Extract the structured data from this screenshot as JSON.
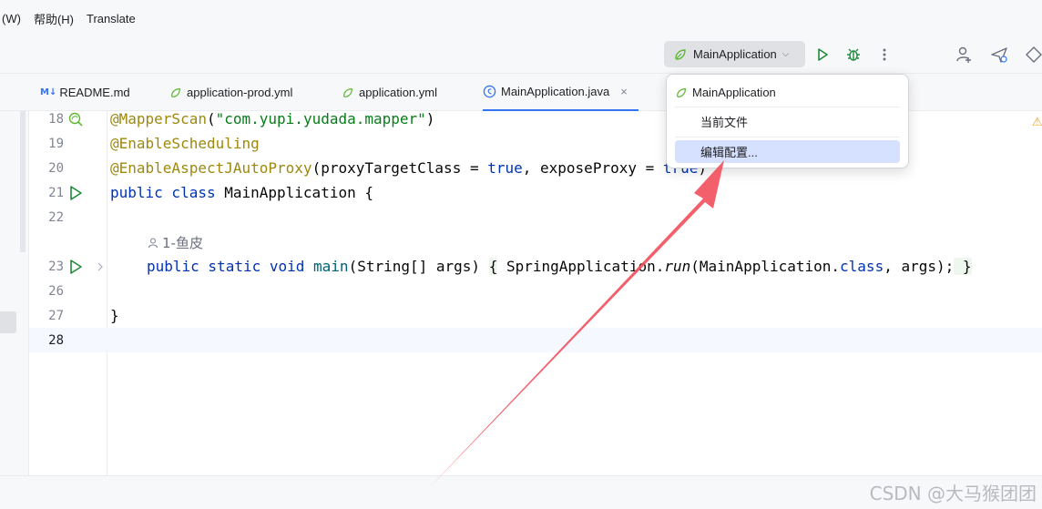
{
  "menu": [
    "(W)",
    "帮助(H)",
    "Translate"
  ],
  "toolbar": {
    "run_config": "MainApplication",
    "icons": [
      "run-icon",
      "debug-icon",
      "more-icon",
      "add-user-icon",
      "deploy-icon",
      "plugin-icon"
    ]
  },
  "tabs": [
    {
      "label": "README.md",
      "badge": "M↓"
    },
    {
      "label": "application-prod.yml"
    },
    {
      "label": "application.yml"
    },
    {
      "label": "MainApplication.java",
      "active": true,
      "close": "×"
    }
  ],
  "editor": {
    "line_numbers": [
      "18",
      "19",
      "20",
      "21",
      "22",
      "23",
      "26",
      "27",
      "28"
    ],
    "lines": {
      "l18_ann": "@MapperScan",
      "l18_open": "(",
      "l18_str": "\"com.yupi.yudada.mapper\"",
      "l18_close": ")",
      "l19": "@EnableScheduling",
      "l20_ann": "@EnableAspectJAutoProxy",
      "l20_rest1": "(proxyTargetClass = ",
      "l20_kw": "true",
      "l20_rest2": ", exposeProxy = ",
      "l20_kw2": "true",
      "l20_close": ")",
      "l21_kw": "public class",
      "l21_rest": " MainApplication {",
      "l23_kw": "public static void",
      "l23_name": " main",
      "l23_args": "(String[] args) ",
      "l23_brace": "{",
      "l23_body1": " SpringApplication.",
      "l23_run": "run",
      "l23_body2": "(MainApplication.",
      "l23_class": "class",
      "l23_body3": ", args);",
      "l23_end": " }",
      "l27": "}"
    },
    "author": "1-鱼皮",
    "warning": "⚠"
  },
  "popup": {
    "items": [
      "MainApplication",
      "当前文件",
      "编辑配置..."
    ],
    "selected_index": 2
  },
  "watermark": "CSDN @大马猴团团",
  "colors": {
    "accent": "#3574f0",
    "arrow": "#f2515e",
    "annotation": "#9e880d",
    "string": "#067d17",
    "keyword": "#0033b3"
  }
}
